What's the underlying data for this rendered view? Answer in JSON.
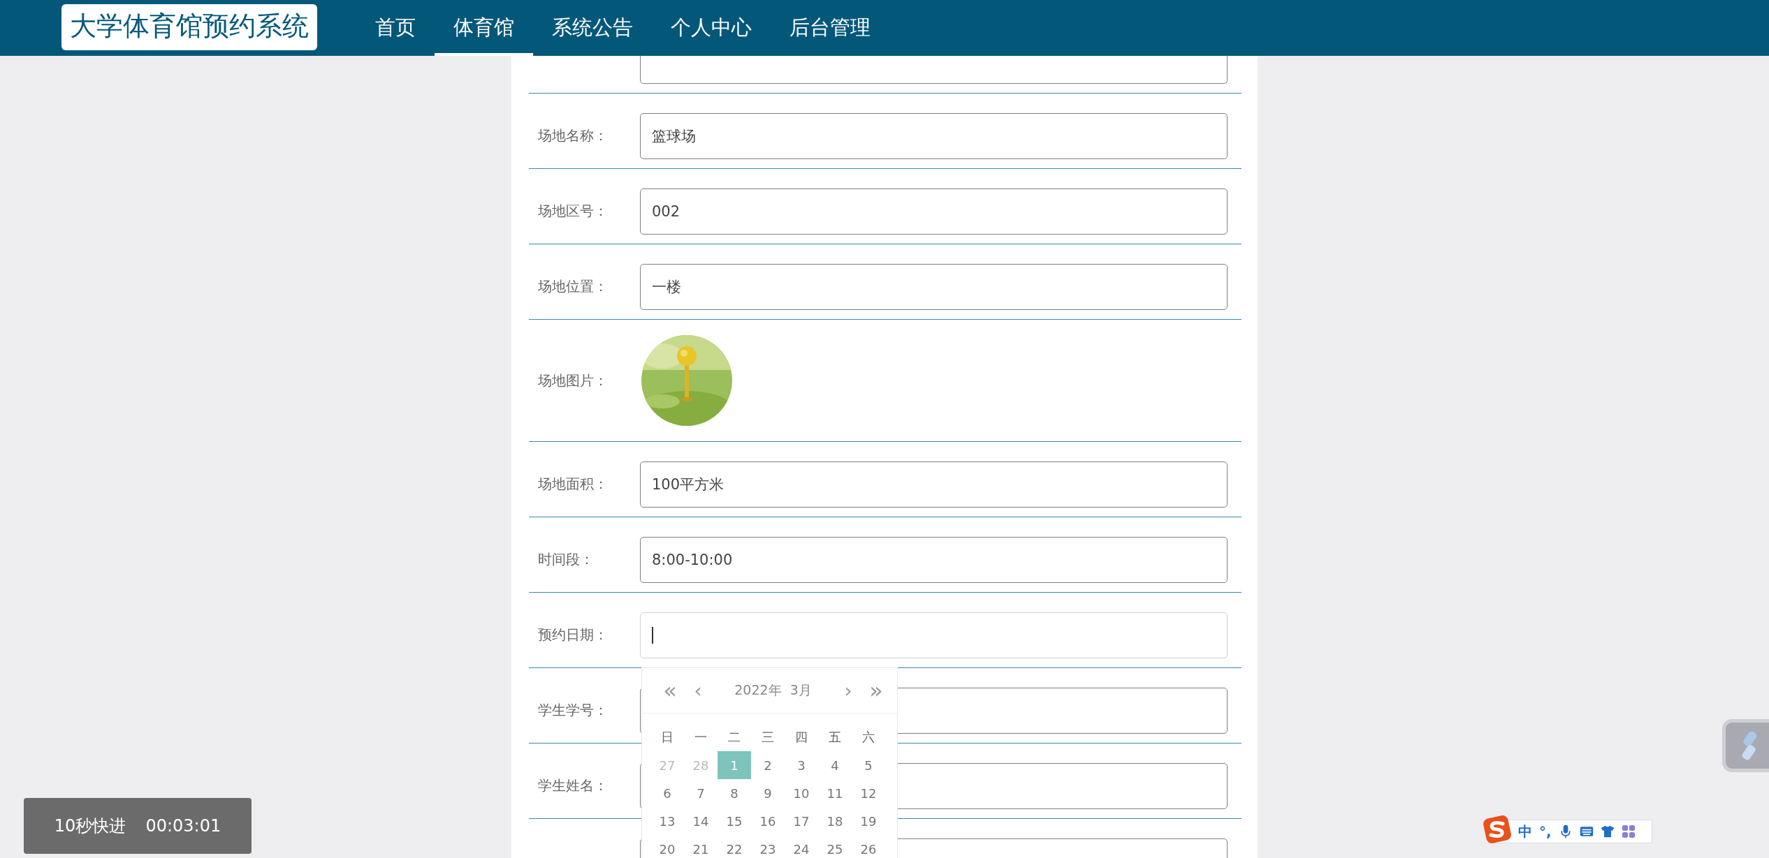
{
  "header": {
    "logo": "大学体育馆预约系统",
    "nav": [
      {
        "label": "首页",
        "selected": false
      },
      {
        "label": "体育馆",
        "selected": true
      },
      {
        "label": "系统公告",
        "selected": false
      },
      {
        "label": "个人中心",
        "selected": false
      },
      {
        "label": "后台管理",
        "selected": false
      }
    ]
  },
  "form": {
    "rows": [
      {
        "kind": "input",
        "focused": false
      },
      {
        "kind": "input",
        "label": "场地名称：",
        "value": "篮球场",
        "focused": false
      },
      {
        "kind": "input",
        "label": "场地区号：",
        "value": "002",
        "focused": false
      },
      {
        "kind": "input",
        "label": "场地位置：",
        "value": "一楼",
        "focused": false
      },
      {
        "label": "场地图片："
      },
      {
        "kind": "input",
        "label": "场地面积：",
        "value": "100平方米",
        "focused": false
      },
      {
        "kind": "input",
        "label": "时间段：",
        "value": "8:00-10:00",
        "focused": false
      },
      {
        "kind": "input",
        "label": "预约日期：",
        "focused": true
      },
      {
        "kind": "input",
        "label": "学生学号：",
        "focused": false
      },
      {
        "kind": "input",
        "label": "学生姓名：",
        "focused": false
      },
      {
        "kind": "input",
        "focused": false
      }
    ]
  },
  "calendar": {
    "title": "2022年  3月",
    "prev_year": "«",
    "prev_month": "‹",
    "next_month": "›",
    "next_year": "»",
    "weekdays": [
      "日",
      "一",
      "二",
      "三",
      "四",
      "五",
      "六"
    ],
    "days": [
      {
        "label": "27",
        "kind": "other",
        "selected": false
      },
      {
        "label": "28",
        "kind": "other",
        "selected": false
      },
      {
        "label": "1",
        "kind": "day",
        "selected": true
      },
      {
        "label": "2",
        "kind": "day",
        "selected": false
      },
      {
        "label": "3",
        "kind": "day",
        "selected": false
      },
      {
        "label": "4",
        "kind": "day",
        "selected": false
      },
      {
        "label": "5",
        "kind": "day",
        "selected": false
      },
      {
        "label": "6",
        "kind": "day",
        "selected": false
      },
      {
        "label": "7",
        "kind": "day",
        "selected": false
      },
      {
        "label": "8",
        "kind": "day",
        "selected": false
      },
      {
        "label": "9",
        "kind": "day",
        "selected": false
      },
      {
        "label": "10",
        "kind": "day",
        "selected": false
      },
      {
        "label": "11",
        "kind": "day",
        "selected": false
      },
      {
        "label": "12",
        "kind": "day",
        "selected": false
      },
      {
        "label": "13",
        "kind": "day",
        "selected": false
      },
      {
        "label": "14",
        "kind": "day",
        "selected": false
      },
      {
        "label": "15",
        "kind": "day",
        "selected": false
      },
      {
        "label": "16",
        "kind": "day",
        "selected": false
      },
      {
        "label": "17",
        "kind": "day",
        "selected": false
      },
      {
        "label": "18",
        "kind": "day",
        "selected": false
      },
      {
        "label": "19",
        "kind": "day",
        "selected": false
      },
      {
        "label": "20",
        "kind": "day",
        "selected": false
      },
      {
        "label": "21",
        "kind": "day",
        "selected": false
      },
      {
        "label": "22",
        "kind": "day",
        "selected": false
      },
      {
        "label": "23",
        "kind": "day",
        "selected": false
      },
      {
        "label": "24",
        "kind": "day",
        "selected": false
      },
      {
        "label": "25",
        "kind": "day",
        "selected": false
      },
      {
        "label": "26",
        "kind": "day",
        "selected": false
      }
    ]
  },
  "video_overlay": {
    "label": "10秒快进",
    "time": "00:03:01"
  },
  "ime_bar": {
    "mode": "中",
    "punct": "°,"
  }
}
